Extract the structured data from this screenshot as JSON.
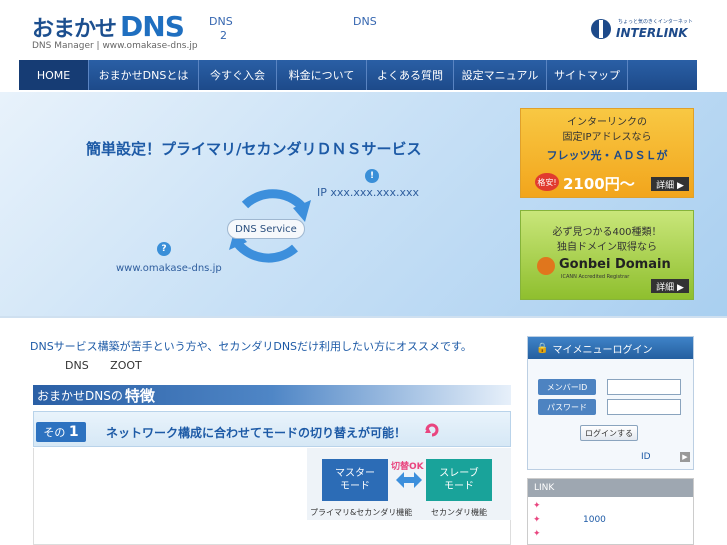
{
  "header": {
    "logo_prefix": "おまかせ",
    "logo_dns": "DNS",
    "logo_sub": "DNS Manager | www.omakase-dns.jp",
    "text_a": "DNS",
    "text_b": "2",
    "text_c": "DNS",
    "brand_tagline": "ちょっと気のきくインターネット",
    "brand_name": "INTERLINK"
  },
  "nav": [
    {
      "label": "HOME",
      "width": 70
    },
    {
      "label": "おまかせDNSとは",
      "width": 110
    },
    {
      "label": "今すぐ入会",
      "width": 78
    },
    {
      "label": "料金について",
      "width": 90
    },
    {
      "label": "よくある質問",
      "width": 87
    },
    {
      "label": "設定マニュアル",
      "width": 93
    },
    {
      "label": "サイトマップ",
      "width": 81
    }
  ],
  "hero": {
    "title": "簡単設定！プライマリ/セカンダリＤＮＳサービス",
    "ip": "IP xxx.xxx.xxx.xxx",
    "site": "www.omakase-dns.jp",
    "service": "DNS Service",
    "pin_glyph": "?",
    "pin2_glyph": "!"
  },
  "ad1": {
    "line1": "インターリンクの",
    "line2": "固定IPアドレスなら",
    "line3": "フレッツ光・ＡＤＳＬが",
    "badge": "格安!",
    "price": "2100円〜",
    "detail": "詳細 ▶"
  },
  "ad2": {
    "line1": "必ず見つかる400種類！",
    "line2": "独自ドメイン取得なら",
    "brand": "Gonbei Domain",
    "brand_sub": "ICANN Accredited Registrar",
    "detail": "詳細 ▶"
  },
  "intro": "DNSサービス構築が苦手という方や、セカンダリDNSだけ利用したい方にオススメです。",
  "sub_row": "DNS ZOOT",
  "feature_bar": {
    "prefix": "おまかせDNSの",
    "emph": "特徴"
  },
  "mode": {
    "num_label": "その",
    "num": "1",
    "text": "ネットワーク構成に合わせてモードの切り替えが可能！",
    "switch_label": "切替OK",
    "master": "マスター\nモード",
    "slave": "スレーブ\nモード",
    "master_caption": "プライマリ&セカンダリ機能",
    "slave_caption": "セカンダリ機能"
  },
  "login": {
    "title": "マイメニューログイン",
    "member_label": "メンバーID",
    "password_label": "パスワード",
    "button": "ログインする",
    "id_text": "ID"
  },
  "link": {
    "title": "LINK",
    "item2": "1000"
  },
  "colors": {
    "nav": "#1d4a8a",
    "brand": "#1f6fc0",
    "accent_orange": "#f2a51c",
    "accent_green": "#8fbf2e"
  }
}
